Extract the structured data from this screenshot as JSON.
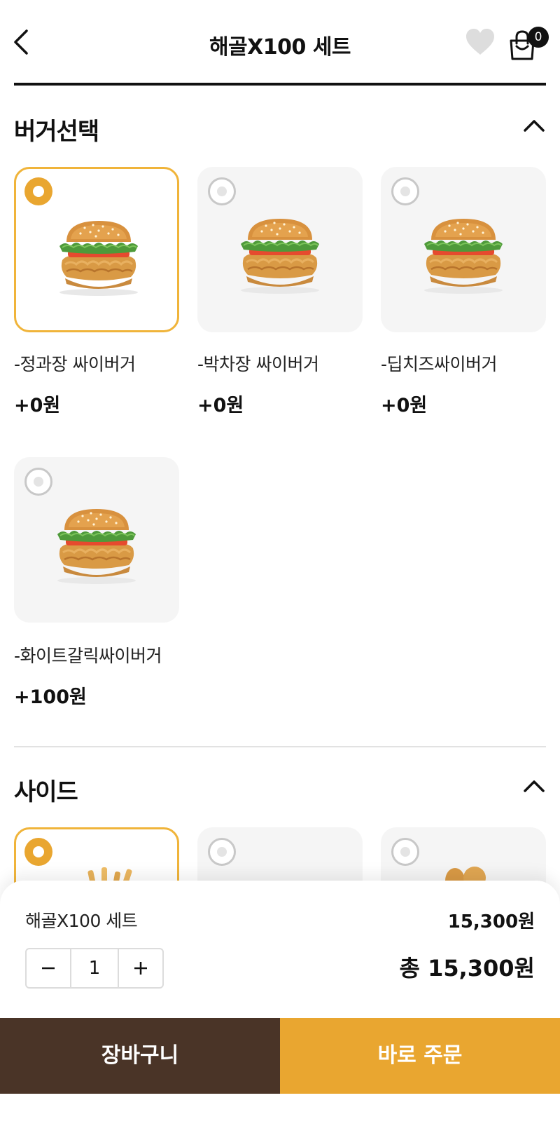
{
  "header": {
    "title": "해골X100 세트",
    "cart_count": "0",
    "back_icon": "chevron-left-icon",
    "favorite_icon": "heart-icon",
    "cart_icon": "shopping-bag-icon"
  },
  "burger_section": {
    "title": "버거선택",
    "items": [
      {
        "name": "-정과장 싸이버거",
        "price": "+0원",
        "selected": true
      },
      {
        "name": "-박차장 싸이버거",
        "price": "+0원",
        "selected": false
      },
      {
        "name": "-딥치즈싸이버거",
        "price": "+0원",
        "selected": false
      },
      {
        "name": "-화이트갈릭싸이버거",
        "price": "+100원",
        "selected": false
      }
    ]
  },
  "side_section": {
    "title": "사이드",
    "selected_index": 0
  },
  "summary": {
    "product_name": "해골X100 세트",
    "unit_price": "15,300원",
    "quantity": "1",
    "total": "총 15,300원"
  },
  "actions": {
    "cart_label": "장바구니",
    "order_label": "바로 주문"
  },
  "colors": {
    "accent": "#e9a630",
    "dark_brown": "#4a3427",
    "selected_border": "#f0b43a"
  }
}
